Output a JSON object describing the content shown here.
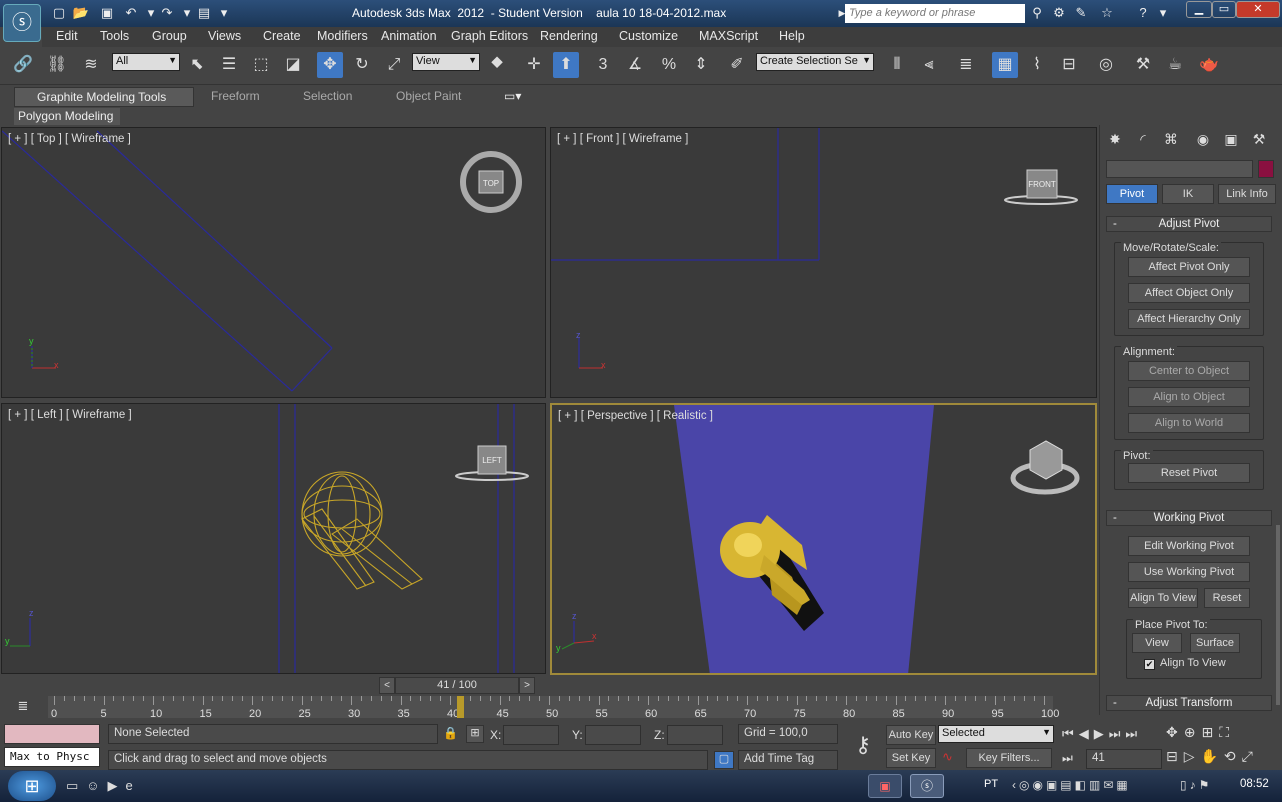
{
  "titlebar": {
    "title": "Autodesk 3ds Max  2012  - Student Version    aula 10 18-04-2012.max",
    "search_placeholder": "Type a keyword or phrase"
  },
  "menu": [
    "Edit",
    "Tools",
    "Group",
    "Views",
    "Create",
    "Modifiers",
    "Animation",
    "Graph Editors",
    "Rendering",
    "Customize",
    "MAXScript",
    "Help"
  ],
  "toolbar": {
    "filter_value": "All",
    "coord_value": "View",
    "selection_set_value": "Create Selection Se",
    "snap_label": "3"
  },
  "ribbon": {
    "tabs": [
      "Graphite Modeling Tools",
      "Freeform",
      "Selection",
      "Object Paint"
    ],
    "panel": "Polygon Modeling"
  },
  "viewports": {
    "top": {
      "label": "[ + ] [ Top ] [ Wireframe ]",
      "cube": "TOP"
    },
    "front": {
      "label": "[ + ] [ Front ] [ Wireframe ]",
      "cube": "FRONT"
    },
    "left": {
      "label": "[ + ] [ Left ] [ Wireframe ]",
      "cube": "LEFT"
    },
    "perspective": {
      "label": "[ + ] [ Perspective ] [ Realistic ]"
    },
    "axis": {
      "x": "x",
      "y": "y",
      "z": "z"
    }
  },
  "command_panel": {
    "tabs": [
      "Pivot",
      "IK",
      "Link Info"
    ],
    "adjust_pivot": {
      "title": "Adjust Pivot",
      "move_group": "Move/Rotate/Scale:",
      "buttons": [
        "Affect Pivot Only",
        "Affect Object Only",
        "Affect Hierarchy Only"
      ],
      "alignment_group": "Alignment:",
      "align_buttons": [
        "Center to Object",
        "Align to Object",
        "Align to World"
      ],
      "pivot_group": "Pivot:",
      "reset": "Reset Pivot"
    },
    "working_pivot": {
      "title": "Working Pivot",
      "edit": "Edit Working Pivot",
      "use": "Use Working Pivot",
      "align_view": "Align To View",
      "reset": "Reset",
      "place_group": "Place Pivot To:",
      "view": "View",
      "surface": "Surface",
      "checkbox": "Align To View",
      "checked": true
    },
    "adjust_transform": "Adjust Transform"
  },
  "timeline": {
    "frame": "41 / 100",
    "ticks": [
      "0",
      "5",
      "10",
      "15",
      "20",
      "25",
      "30",
      "35",
      "40",
      "45",
      "50",
      "55",
      "60",
      "65",
      "70",
      "75",
      "80",
      "85",
      "90",
      "95",
      "100"
    ],
    "current": 41
  },
  "status": {
    "script": "Max to Physc",
    "selection": "None Selected",
    "prompt": "Click and drag to select and move objects",
    "x_label": "X:",
    "y_label": "Y:",
    "z_label": "Z:",
    "grid": "Grid = 100,0",
    "add_time_tag": "Add Time Tag",
    "auto_key": "Auto Key",
    "set_key": "Set Key",
    "key_mode": "Selected",
    "key_filters": "Key Filters...",
    "frame_field": "41"
  },
  "taskbar": {
    "language": "PT",
    "clock": "08:52"
  },
  "colors": {
    "accent": "#3f78c4",
    "object": "#c8a628",
    "plane": "#4a45a8"
  }
}
